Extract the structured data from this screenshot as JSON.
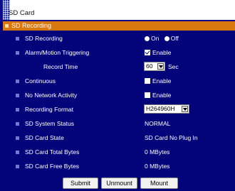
{
  "window": {
    "title": "SD Card"
  },
  "section": {
    "title": "SD Recording"
  },
  "fields": {
    "sd_recording": {
      "label": "SD Recording",
      "on_label": "On",
      "off_label": "Off",
      "selected": "Off"
    },
    "alarm_motion": {
      "label": "Alarm/Motion Triggering",
      "checkbox_label": "Enable",
      "checked": true
    },
    "record_time": {
      "label": "Record Time",
      "value": "60",
      "unit": "Sec"
    },
    "continuous": {
      "label": "Continuous",
      "checkbox_label": "Enable",
      "checked": false
    },
    "no_network": {
      "label": "No Network Activity",
      "checkbox_label": "Enable",
      "checked": false
    },
    "recording_format": {
      "label": "Recording Format",
      "value": "H264960H"
    },
    "system_status": {
      "label": "SD System Status",
      "value": "NORMAL"
    },
    "card_state": {
      "label": "SD Card State",
      "value": "SD Card No Plug In"
    },
    "total_bytes": {
      "label": "SD Card Total Bytes",
      "value": "0 MBytes"
    },
    "free_bytes": {
      "label": "SD Card Free Bytes",
      "value": "0 MBytes"
    }
  },
  "buttons": {
    "submit": "Submit",
    "unmount": "Unmount",
    "mount": "Mount"
  },
  "colors": {
    "panel_bg": "#03037a",
    "section_bg": "#d9780f",
    "bullet": "#6b7bd6"
  }
}
